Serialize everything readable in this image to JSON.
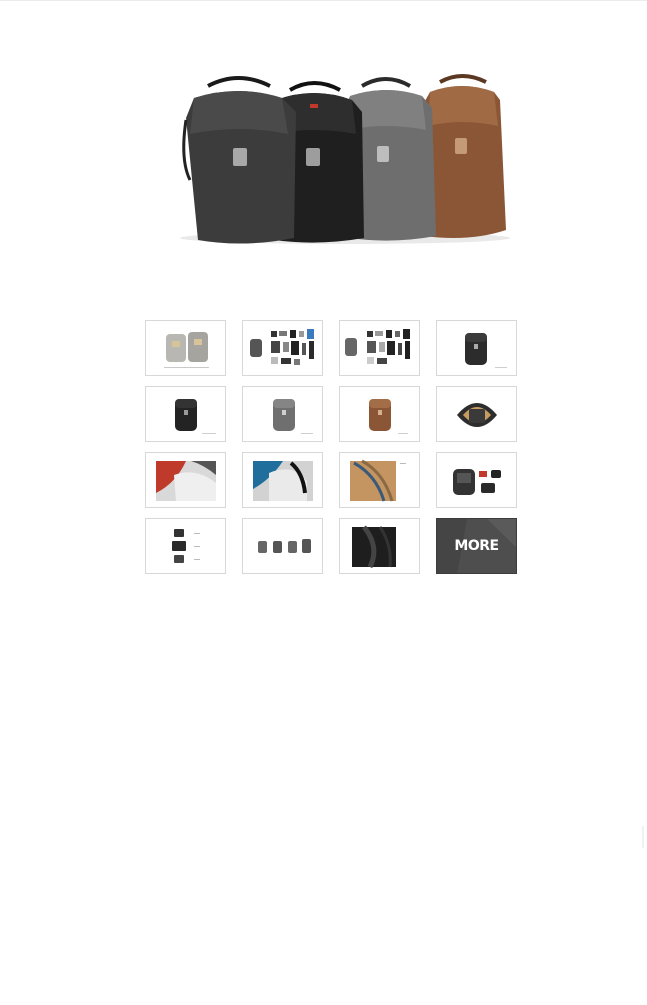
{
  "hero": {
    "image": "product-lineup-four-backpacks",
    "colors": [
      "#3c3c3c",
      "#1f1f1f",
      "#6e6e6e",
      "#8a5636"
    ]
  },
  "gallery": {
    "thumbnails": [
      {
        "name": "thumb-two-backpacks",
        "content": "two-backpacks"
      },
      {
        "name": "thumb-flatlay-gear-1",
        "content": "flatlay"
      },
      {
        "name": "thumb-flatlay-gear-2",
        "content": "flatlay"
      },
      {
        "name": "thumb-black-backpack",
        "content": "backpack"
      },
      {
        "name": "thumb-black-backpack-2",
        "content": "backpack"
      },
      {
        "name": "thumb-grey-backpack",
        "content": "backpack"
      },
      {
        "name": "thumb-tan-backpack",
        "content": "backpack"
      },
      {
        "name": "thumb-backpack-open",
        "content": "open"
      },
      {
        "name": "thumb-interior-red",
        "content": "interior"
      },
      {
        "name": "thumb-interior-blue",
        "content": "interior"
      },
      {
        "name": "thumb-interior-tan",
        "content": "interior"
      },
      {
        "name": "thumb-backpack-accessories",
        "content": "accessories"
      },
      {
        "name": "thumb-camera-inserts",
        "content": "inserts"
      },
      {
        "name": "thumb-dividers",
        "content": "dividers"
      },
      {
        "name": "thumb-detail-closeup",
        "content": "closeup"
      }
    ],
    "more_label": "MORE"
  }
}
